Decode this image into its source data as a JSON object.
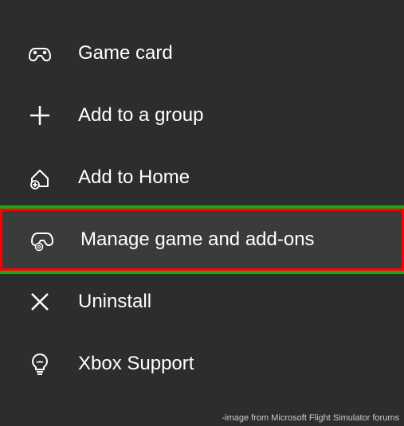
{
  "menu": {
    "items": [
      {
        "label": "Game card"
      },
      {
        "label": "Add to a group"
      },
      {
        "label": "Add to Home"
      },
      {
        "label": "Manage game and add-ons"
      },
      {
        "label": "Uninstall"
      },
      {
        "label": "Xbox Support"
      }
    ]
  },
  "attribution": "-image from Microsoft Flight Simulator forums"
}
